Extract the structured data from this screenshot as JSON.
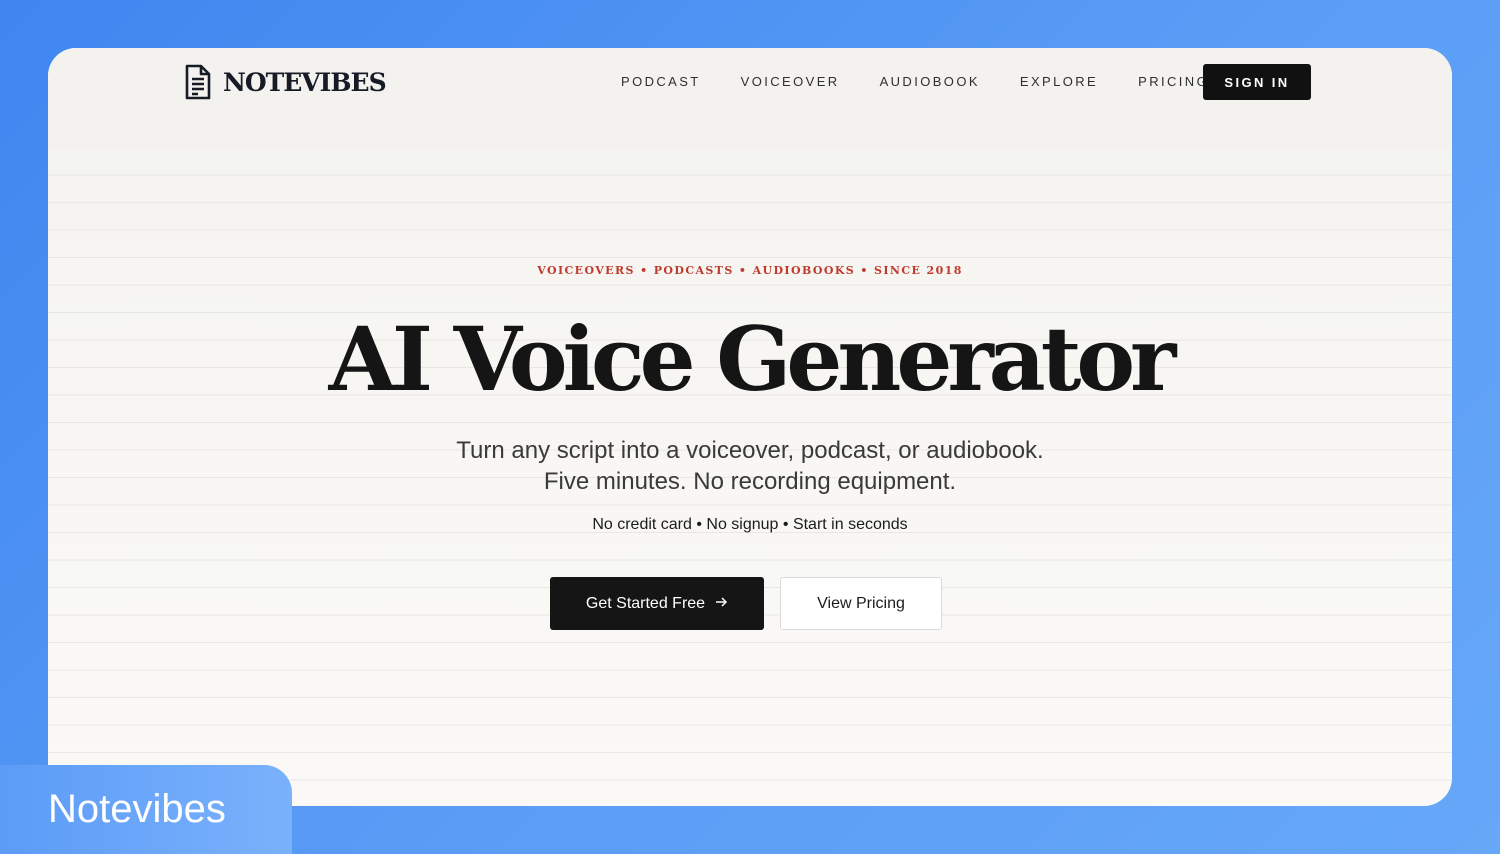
{
  "brand": {
    "name": "NOTEVIBES",
    "icon": "document-icon"
  },
  "nav": {
    "items": [
      {
        "label": "PODCAST"
      },
      {
        "label": "VOICEOVER"
      },
      {
        "label": "AUDIOBOOK"
      },
      {
        "label": "EXPLORE"
      },
      {
        "label": "PRICING"
      }
    ],
    "signin_label": "SIGN IN"
  },
  "hero": {
    "eyebrow": "VOICEOVERS • PODCASTS • AUDIOBOOKS • SINCE 2018",
    "headline": "AI Voice Generator",
    "subhead": "Turn any script into a voiceover, podcast, or audiobook. Five minutes. No recording equipment.",
    "perks": "No credit card • No signup • Start in seconds",
    "primary_cta": "Get Started Free",
    "primary_cta_icon": "arrow-right-icon",
    "secondary_cta": "View Pricing"
  },
  "badge": {
    "label": "Notevibes"
  },
  "colors": {
    "background_blue": "#4a90f0",
    "accent_red": "#c0392b",
    "primary_dark": "#151515",
    "page_bg": "#f3f2ef"
  }
}
